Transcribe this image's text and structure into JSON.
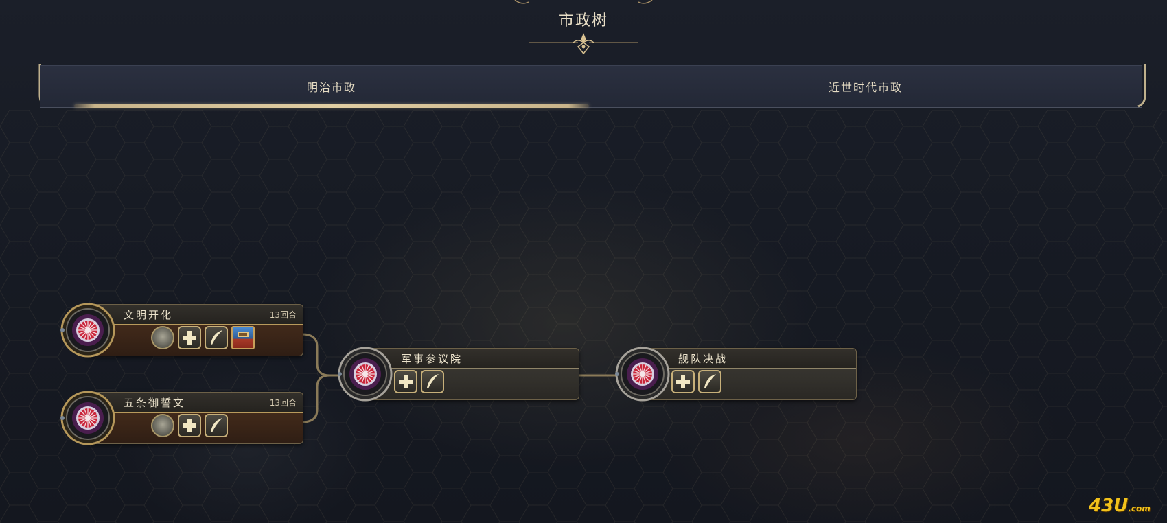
{
  "screen": {
    "title": "市政树"
  },
  "tabs": [
    {
      "label": "明治市政",
      "selected": true
    },
    {
      "label": "近世时代市政",
      "selected": false
    }
  ],
  "civics": [
    {
      "name": "文明开化",
      "turns": "13回合",
      "unlocks": [
        "district-round-icon",
        "plus-icon",
        "quill-icon",
        "card-icon"
      ]
    },
    {
      "name": "五条御誓文",
      "turns": "13回合",
      "unlocks": [
        "district-round-icon",
        "plus-icon",
        "quill-icon"
      ]
    },
    {
      "name": "军事参议院",
      "turns": "",
      "unlocks": [
        "plus-icon",
        "quill-icon"
      ]
    },
    {
      "name": "舰队决战",
      "turns": "",
      "unlocks": [
        "plus-icon",
        "quill-icon"
      ]
    }
  ],
  "watermark": {
    "main": "43U",
    "suffix": ".com"
  },
  "colors": {
    "accent_gold": "#c9b48a",
    "text_light": "#e9dfc7",
    "panel_brown": "#3c2618",
    "panel_gray": "#33312c"
  }
}
